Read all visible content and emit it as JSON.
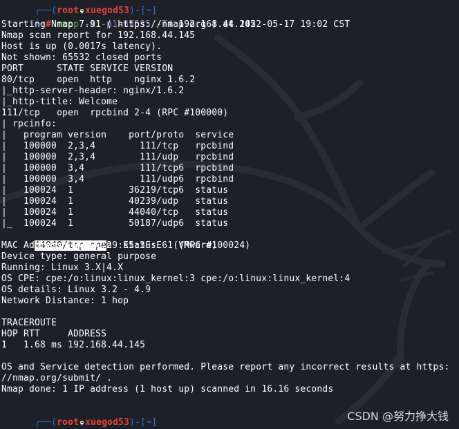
{
  "app": {
    "watermark": "CSDN @努力挣大钱"
  },
  "prompt": {
    "top_open": "┌──(",
    "user": "root",
    "skull": "skull-icon",
    "host": "xuegod53",
    "after_host": ")-[",
    "dir": "~",
    "end": "]",
    "second_prefix": "└─",
    "hash": "#"
  },
  "command": {
    "nmap": "nmap",
    "args": "-A -p1-65535 -T4",
    "target": "192.168.44.145"
  },
  "output": {
    "line_3": "Starting Nmap 7.91 ( https://nmap.org ) at 2022-05-17 19:02 CST",
    "line_4": "Nmap scan report for 192.168.44.145",
    "line_5": "Host is up (0.0017s latency).",
    "line_6": "Not shown: 65532 closed ports",
    "line_7": "PORT      STATE SERVICE VERSION",
    "line_8": "80/tcp    open  http    nginx 1.6.2",
    "line_9": "|_http-server-header: nginx/1.6.2",
    "line_10": "|_http-title: Welcome",
    "line_11": "111/tcp   open  rpcbind 2-4 (RPC #100000)",
    "line_12": "| rpcinfo:",
    "line_13": "|   program version    port/proto  service",
    "line_14": "|   100000  2,3,4        111/tcp   rpcbind",
    "line_15": "|   100000  2,3,4        111/udp   rpcbind",
    "line_16": "|   100000  3,4          111/tcp6  rpcbind",
    "line_17": "|   100000  3,4          111/udp6  rpcbind",
    "line_18": "|   100024  1          36219/tcp6  status",
    "line_19": "|   100024  1          40239/udp   status",
    "line_20": "|   100024  1          44040/tcp   status",
    "line_21": "|_  100024  1          50187/udp6  status",
    "line_22_selected": "44040/tcp ope",
    "line_22_rest": "n  status  1 (RPC #100024)",
    "line_23": "MAC Address: 00:0C:29:E5:3F:E6 (VMware)",
    "line_24": "Device type: general purpose",
    "line_25": "Running: Linux 3.X|4.X",
    "line_26": "OS CPE: cpe:/o:linux:linux_kernel:3 cpe:/o:linux:linux_kernel:4",
    "line_27": "OS details: Linux 3.2 - 4.9",
    "line_28": "Network Distance: 1 hop",
    "line_30": "TRACEROUTE",
    "line_31": "HOP RTT     ADDRESS",
    "line_32": "1   1.68 ms 192.168.44.145",
    "line_34": "OS and Service detection performed. Please report any incorrect results at https:",
    "line_35": "//nmap.org/submit/ .",
    "line_36": "Nmap done: 1 IP address (1 host up) scanned in 16.16 seconds"
  },
  "colors": {
    "background": "#1e2027",
    "prompt_blue": "#2f6fd6",
    "prompt_red": "#e0443b",
    "command_green": "#4fb34c",
    "command_purple": "#9b7cc1",
    "selection": "#ffffff"
  }
}
